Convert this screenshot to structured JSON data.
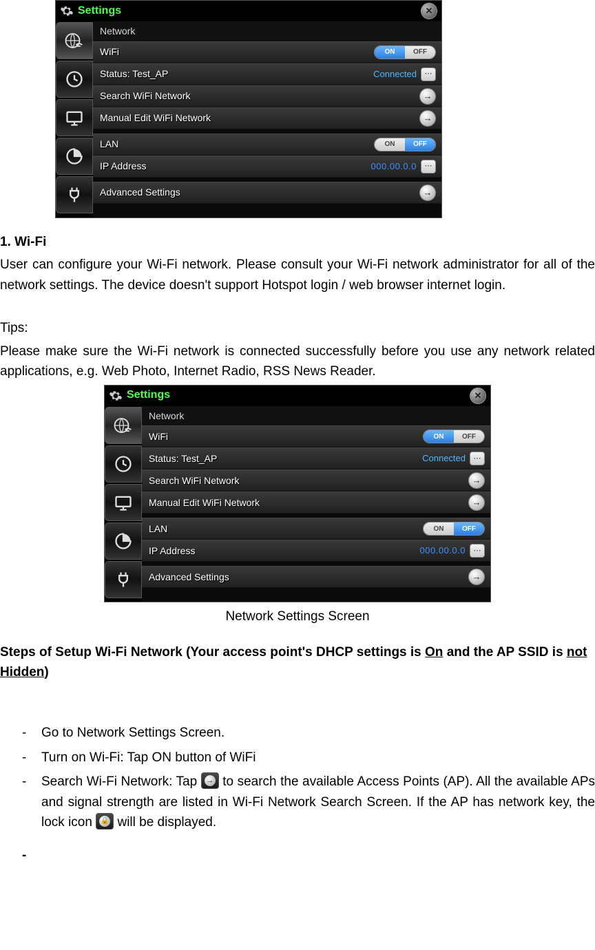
{
  "screenshot": {
    "title": "Settings",
    "section_network": "Network",
    "wifi_label": "WiFi",
    "toggle_on": "ON",
    "toggle_off": "OFF",
    "status_label": "Status: Test_AP",
    "status_value": "Connected",
    "search_label": "Search WiFi Network",
    "manual_label": "Manual Edit WiFi Network",
    "lan_label": "LAN",
    "ip_label": "IP Address",
    "ip_value": "000.00.0.0",
    "advanced_label": "Advanced Settings"
  },
  "doc": {
    "h1": "1. Wi-Fi",
    "p1": "User can configure your Wi-Fi network. Please consult your Wi-Fi network administrator for all of the network settings. The device doesn't support Hotspot login / web browser internet login.",
    "tips_label": "Tips:",
    "tips_body": "Please make sure the Wi-Fi network is connected successfully before you use any network related applications, e.g. Web Photo, Internet Radio, RSS News Reader.",
    "caption": "Network Settings Screen",
    "steps_head_a": "Steps of Setup Wi-Fi Network (Your access point's DHCP settings is ",
    "steps_head_on": "On",
    "steps_head_b": " and the AP SSID is ",
    "steps_head_nh": "not Hidden",
    "steps_head_c": ")",
    "step1": "Go to Network Settings Screen.",
    "step2": "Turn on Wi-Fi: Tap ON button of WiFi",
    "step3a": "Search Wi-Fi Network: Tap ",
    "step3b": " to search the available Access Points (AP). All the available APs and signal strength are listed in Wi-Fi Network Search Screen. If the AP has network key, the lock icon ",
    "step3c": " will be displayed.",
    "trailing_dash": "-"
  }
}
